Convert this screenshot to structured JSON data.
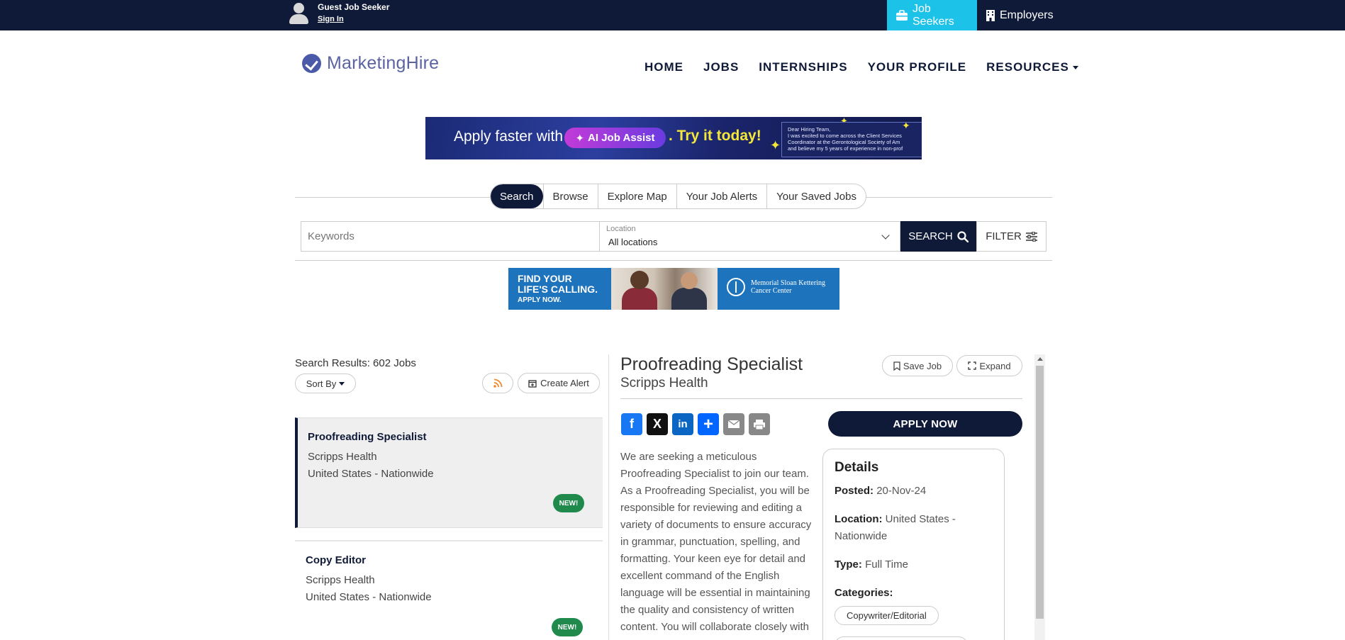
{
  "topbar": {
    "guest_name": "Guest Job Seeker",
    "sign_in": "Sign In",
    "job_seekers": "Job Seekers",
    "employers": "Employers"
  },
  "header": {
    "logo": "MarketingHire",
    "nav": [
      "HOME",
      "JOBS",
      "INTERNSHIPS",
      "YOUR PROFILE",
      "RESOURCES"
    ]
  },
  "banner1": {
    "apply": "Apply faster with",
    "pill": "AI Job Assist",
    "try": ". Try it today!",
    "letter": [
      "Dear Hiring Team,",
      "I was excited to come across the Client Services",
      "Coordinator at the Gerontological Society of Am",
      "and believe my 5 years of experience in non-prof"
    ]
  },
  "tabs": [
    "Search",
    "Browse",
    "Explore Map",
    "Your Job Alerts",
    "Your Saved Jobs"
  ],
  "search": {
    "keywords_placeholder": "Keywords",
    "location_label": "Location",
    "location_value": "All locations",
    "search_button": "SEARCH",
    "filter_button": "FILTER"
  },
  "banner2": {
    "line1": "FIND YOUR",
    "line2": "LIFE'S CALLING.",
    "line3": "APPLY NOW.",
    "org1": "Memorial Sloan Kettering",
    "org2": "Cancer Center"
  },
  "results": {
    "title": "Search Results: 602 Jobs",
    "sort_by": "Sort By",
    "create_alert": "Create Alert",
    "jobs": [
      {
        "title": "Proofreading Specialist",
        "company": "Scripps Health",
        "location": "United States - Nationwide",
        "badge": "NEW!"
      },
      {
        "title": "Copy Editor",
        "company": "Scripps Health",
        "location": "United States - Nationwide",
        "badge": "NEW!"
      }
    ]
  },
  "detail": {
    "title": "Proofreading Specialist",
    "company": "Scripps Health",
    "save_job": "Save Job",
    "expand": "Expand",
    "apply_now": "APPLY NOW",
    "description": "We are seeking a meticulous Proofreading Specialist to join our team. As a Proofreading Specialist, you will be responsible for reviewing and editing a variety of documents to ensure accuracy in grammar, punctuation, spelling, and formatting. Your keen eye for detail and excellent command of the English language will be essential in maintaining the quality and consistency of written content. You will collaborate closely with",
    "details_heading": "Details",
    "posted_label": "Posted:",
    "posted_value": "20-Nov-24",
    "location_label": "Location:",
    "location_value": "United States - Nationwide",
    "type_label": "Type:",
    "type_value": "Full Time",
    "categories_label": "Categories:",
    "category": "Copywriter/Editorial"
  },
  "colors": {
    "navy": "#0f1a38",
    "cyan": "#1cc2e8",
    "new_badge": "#1f8a4c"
  }
}
